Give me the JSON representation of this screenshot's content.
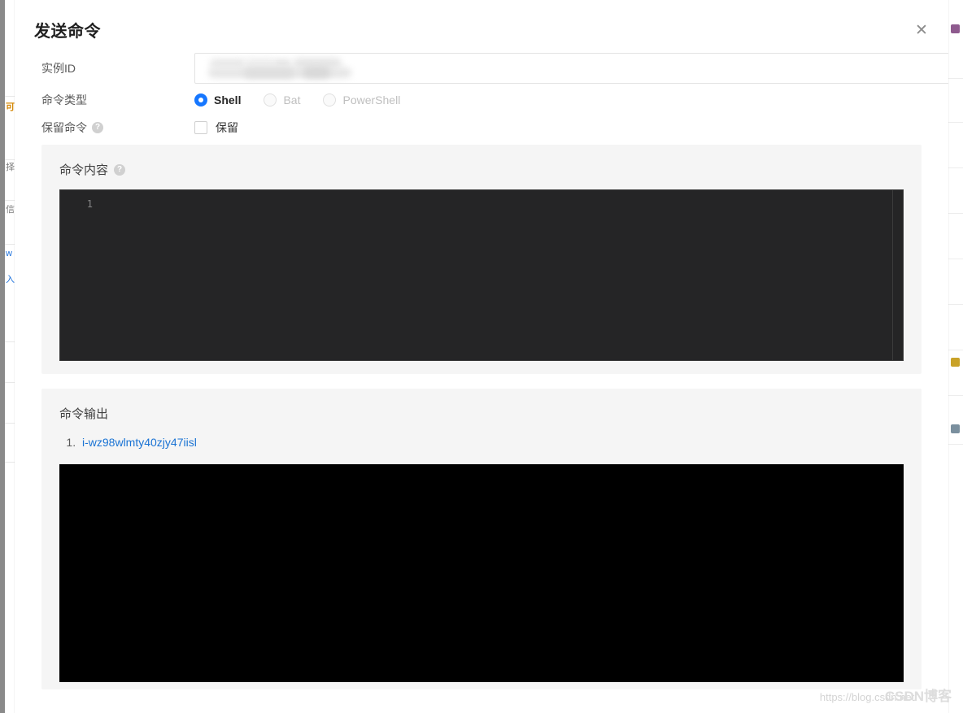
{
  "dialog": {
    "title": "发送命令",
    "close_icon": "close-icon"
  },
  "form": {
    "instance_id": {
      "label": "实例ID",
      "value": "",
      "placeholder": "",
      "redacted": true
    },
    "command_type": {
      "label": "命令类型",
      "selected": "Shell",
      "options": [
        {
          "label": "Shell",
          "value": "shell",
          "checked": true,
          "disabled": false
        },
        {
          "label": "Bat",
          "value": "bat",
          "checked": false,
          "disabled": true
        },
        {
          "label": "PowerShell",
          "value": "powershell",
          "checked": false,
          "disabled": true
        }
      ]
    },
    "retain_command": {
      "label": "保留命令",
      "help_icon": "question-mark-icon",
      "help_glyph": "?",
      "checkbox_label": "保留",
      "checked": false
    }
  },
  "command_panel": {
    "title": "命令内容",
    "help_icon": "question-mark-icon",
    "help_glyph": "?",
    "editor": {
      "line_numbers": [
        "1"
      ],
      "lines": [
        ""
      ]
    }
  },
  "output_panel": {
    "title": "命令输出",
    "items": [
      {
        "index": "1.",
        "label": "i-wz98wlmty40zjy47iisl"
      }
    ],
    "terminal_text": ""
  },
  "watermark": {
    "url": "https://blog.csdn.net/",
    "brand": "CSDN博客"
  },
  "colors": {
    "accent": "#1677ff",
    "link": "#1a73d4",
    "panel_bg": "#f5f5f5",
    "editor_bg": "#252526",
    "terminal_bg": "#000000",
    "title_text": "#1f1f1f",
    "label_text": "#595959"
  }
}
